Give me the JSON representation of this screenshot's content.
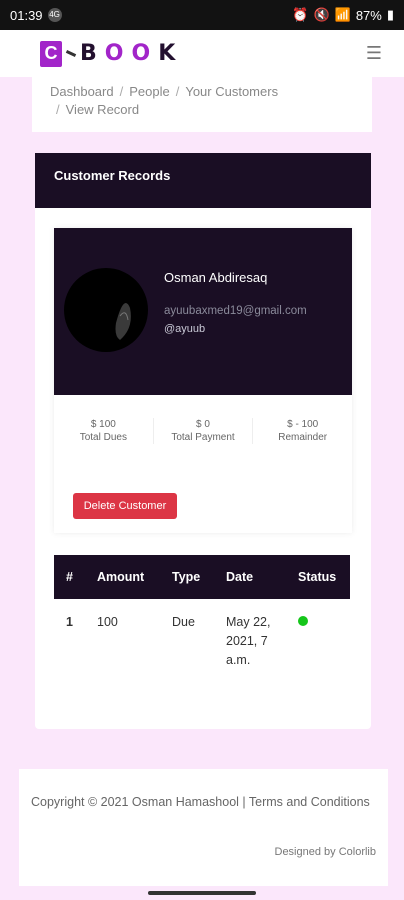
{
  "status_bar": {
    "time": "01:39",
    "battery": "87%",
    "sim_badge": "4G"
  },
  "brand": {
    "c_letter": "C",
    "rest": "BOOK",
    "accent_color": "#a225c9"
  },
  "breadcrumb": {
    "items": [
      "Dashboard",
      "People",
      "Your Customers",
      "View Record"
    ]
  },
  "card": {
    "title": "Customer Records"
  },
  "profile": {
    "name": "Osman Abdiresaq",
    "email": "ayuubaxmed19@gmail.com",
    "handle": "@ayuub",
    "stats": [
      {
        "value": "$ 100",
        "label": "Total Dues"
      },
      {
        "value": "$ 0",
        "label": "Total Payment"
      },
      {
        "value": "$ - 100",
        "label": "Remainder"
      }
    ],
    "delete_label": "Delete Customer"
  },
  "records": {
    "headers": [
      "#",
      "Amount",
      "Type",
      "Date",
      "Status"
    ],
    "rows": [
      {
        "num": "1",
        "amount": "100",
        "type": "Due",
        "date": "May 22, 2021, 7 a.m.",
        "status_color": "#15c61a"
      }
    ]
  },
  "footer": {
    "copyright": "Copyright © 2021 Osman Hamashool | Terms and Conditions",
    "designed": "Designed by Colorlib"
  }
}
